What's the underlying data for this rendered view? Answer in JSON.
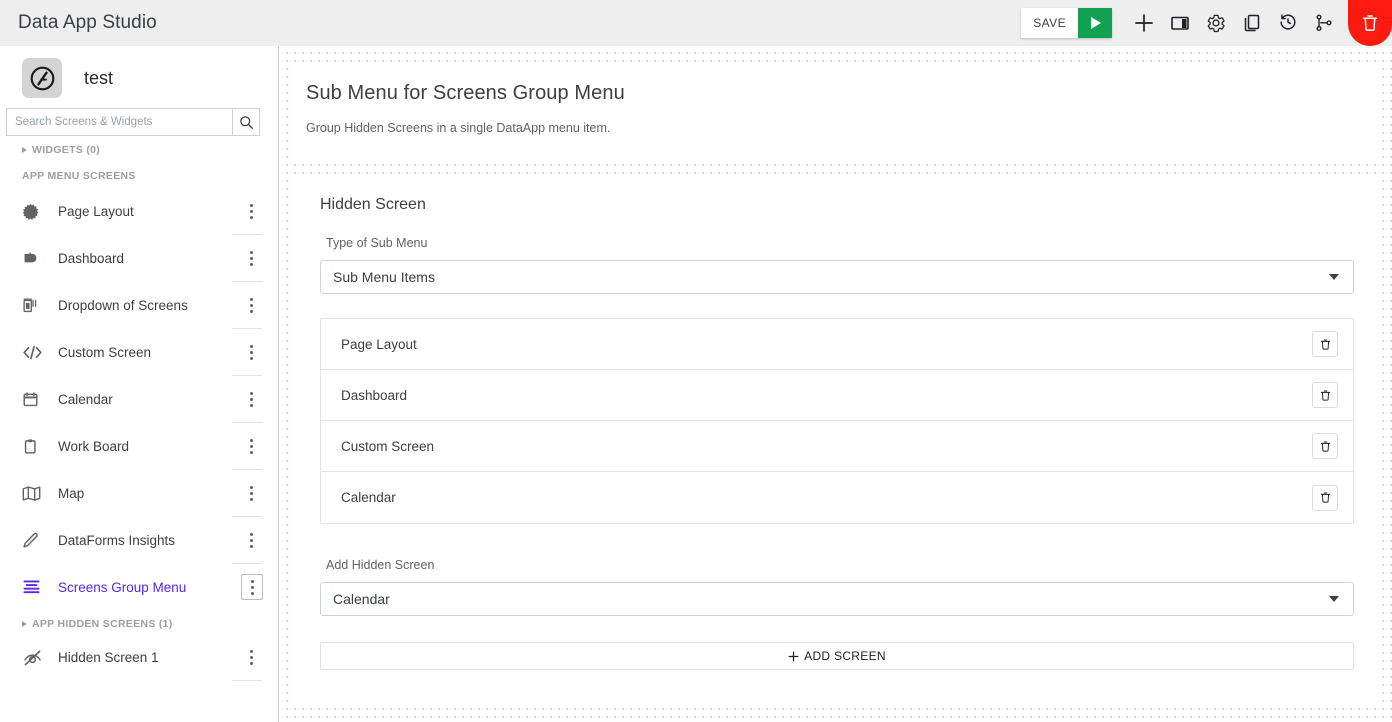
{
  "topbar": {
    "title": "Data App Studio",
    "save_label": "SAVE",
    "icons": [
      {
        "name": "run-play-icon"
      },
      {
        "name": "add-plus-icon"
      },
      {
        "name": "panel-layout-icon"
      },
      {
        "name": "gear-settings-icon"
      },
      {
        "name": "copy-duplicate-icon"
      },
      {
        "name": "history-clock-icon"
      },
      {
        "name": "branch-version-icon"
      },
      {
        "name": "delete-trash-icon"
      }
    ]
  },
  "sidebar": {
    "app_name": "test",
    "logo_icon": "circle-slash-logo-icon",
    "search": {
      "placeholder": "Search Screens & Widgets",
      "value": "",
      "icon": "search-icon"
    },
    "widgets_section": "WIDGETS (0)",
    "app_menu_section": "APP MENU SCREENS",
    "items": [
      {
        "label": "Page Layout",
        "icon": "starburst-icon"
      },
      {
        "label": "Dashboard",
        "icon": "dashboard-icon"
      },
      {
        "label": "Dropdown of Screens",
        "icon": "dropdown-screens-icon"
      },
      {
        "label": "Custom Screen",
        "icon": "code-brackets-icon"
      },
      {
        "label": "Calendar",
        "icon": "calendar-icon"
      },
      {
        "label": "Work Board",
        "icon": "clipboard-icon"
      },
      {
        "label": "Map",
        "icon": "map-icon"
      },
      {
        "label": "DataForms Insights",
        "icon": "pencil-icon"
      },
      {
        "label": "Screens Group Menu",
        "icon": "menu-lines-icon",
        "active": true
      }
    ],
    "hidden_section": "APP HIDDEN SCREENS (1)",
    "hidden_items": [
      {
        "label": "Hidden Screen 1",
        "icon": "eye-off-icon"
      }
    ],
    "accent_color": "#5b27e8"
  },
  "main": {
    "header": {
      "title": "Sub Menu for Screens Group Menu",
      "subtitle": "Group Hidden Screens in a single DataApp menu item."
    },
    "body": {
      "section_title": "Hidden Screen",
      "type_label": "Type of Sub Menu",
      "type_value": "Sub Menu Items",
      "sub_menu_items": [
        {
          "name": "Page Layout",
          "delete_icon": "trash-icon"
        },
        {
          "name": "Dashboard",
          "delete_icon": "trash-icon"
        },
        {
          "name": "Custom Screen",
          "delete_icon": "trash-icon"
        },
        {
          "name": "Calendar",
          "delete_icon": "trash-icon"
        }
      ],
      "add_label": "Add Hidden Screen",
      "add_value": "Calendar",
      "add_button": "ADD SCREEN"
    }
  }
}
